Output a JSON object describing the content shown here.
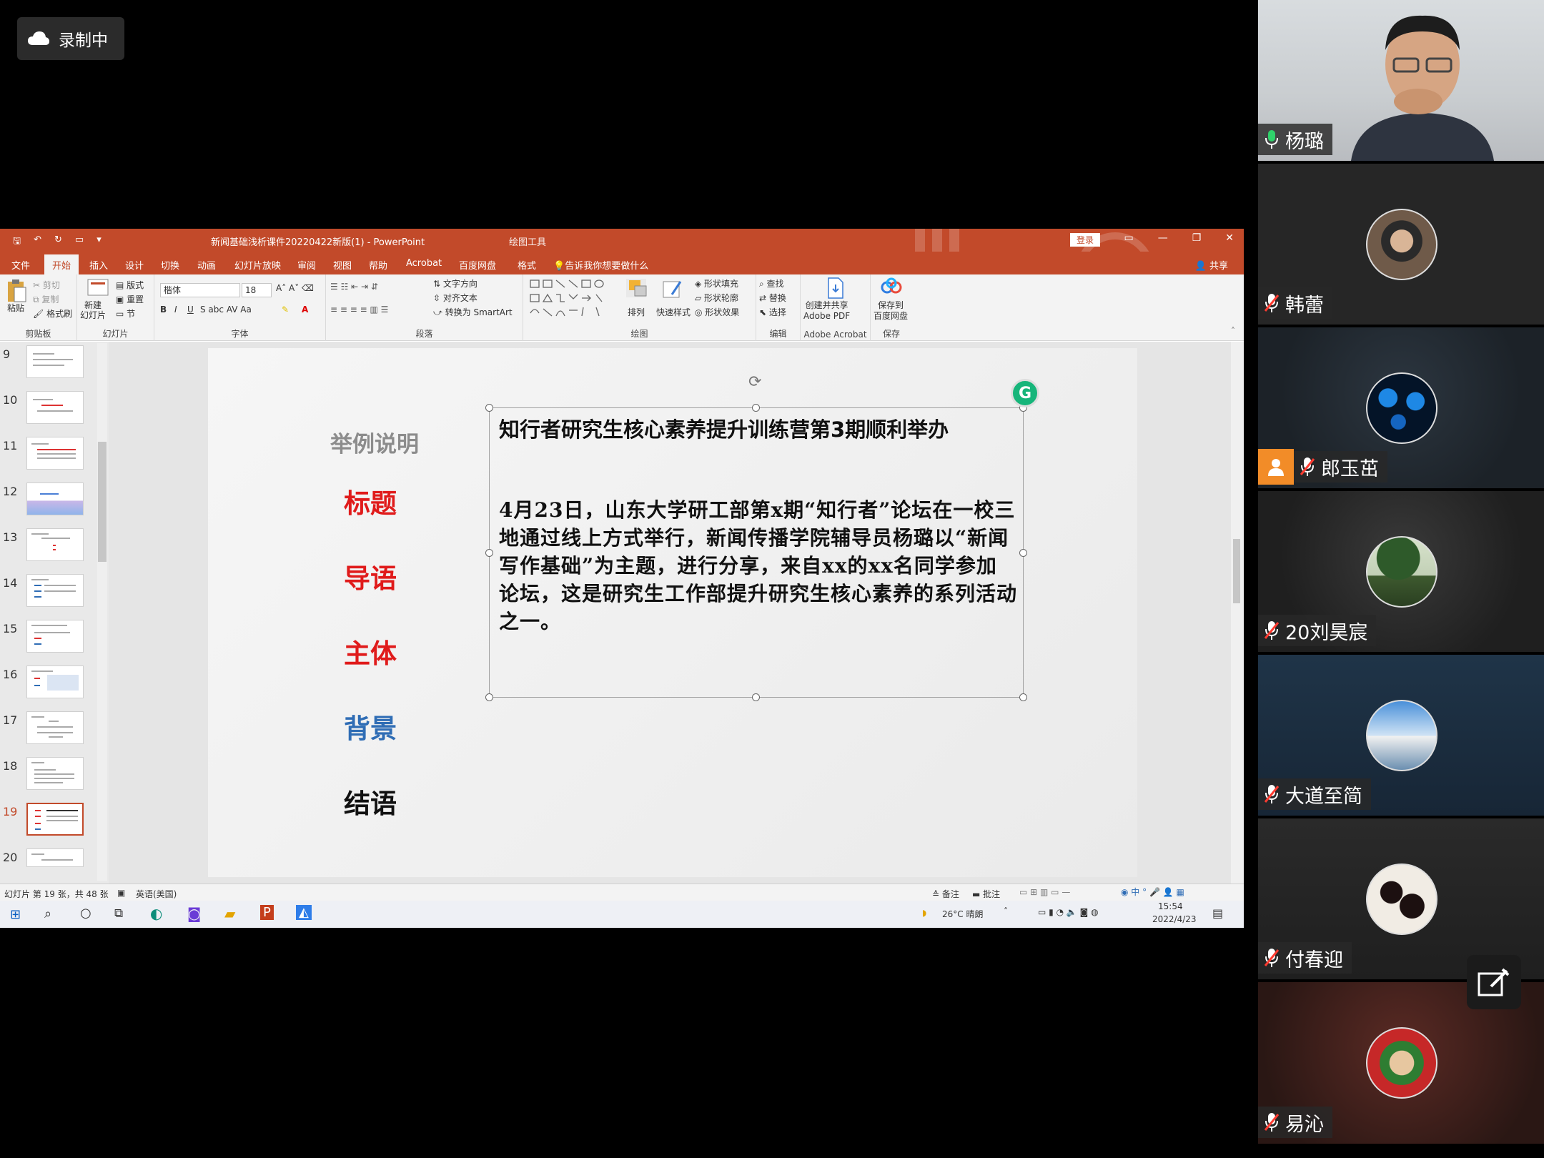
{
  "recording": {
    "label": "录制中"
  },
  "ppt": {
    "title": "新闻基础浅析课件20220422新版(1)  -  PowerPoint",
    "context_tab": "绘图工具",
    "login": "登录",
    "tabs": [
      "文件",
      "开始",
      "插入",
      "设计",
      "切换",
      "动画",
      "幻灯片放映",
      "审阅",
      "视图",
      "帮助",
      "Acrobat",
      "百度网盘",
      "格式"
    ],
    "tell_me": "告诉我你想要做什么",
    "share": "共享",
    "ribbon": {
      "clipboard": {
        "paste": "粘贴",
        "cut": "剪切",
        "copy": "复制",
        "format_painter": "格式刷",
        "label": "剪贴板"
      },
      "slides": {
        "new_slide": "新建\n幻灯片",
        "layout": "版式",
        "reset": "重置",
        "section": "节",
        "label": "幻灯片"
      },
      "font": {
        "name": "楷体",
        "size": "18",
        "label": "字体"
      },
      "paragraph": {
        "text_direction": "文字方向",
        "align_text": "对齐文本",
        "smartart": "转换为 SmartArt",
        "label": "段落"
      },
      "drawing": {
        "arrange": "排列",
        "quick_styles": "快速样式",
        "shape_fill": "形状填充",
        "shape_outline": "形状轮廓",
        "shape_effects": "形状效果",
        "label": "绘图"
      },
      "editing": {
        "find": "查找",
        "replace": "替换",
        "select": "选择",
        "label": "编辑"
      },
      "acrobat": {
        "create": "创建并共享\nAdobe PDF",
        "label": "Adobe Acrobat"
      },
      "save": {
        "button": "保存到\n百度网盘",
        "label": "保存"
      }
    },
    "thumbnails": [
      {
        "num": "9"
      },
      {
        "num": "10"
      },
      {
        "num": "11"
      },
      {
        "num": "12"
      },
      {
        "num": "13"
      },
      {
        "num": "14"
      },
      {
        "num": "15"
      },
      {
        "num": "16"
      },
      {
        "num": "17"
      },
      {
        "num": "18"
      },
      {
        "num": "19"
      },
      {
        "num": "20"
      }
    ],
    "slide": {
      "heading": "举例说明",
      "items": [
        "标题",
        "导语",
        "主体",
        "背景",
        "结语"
      ],
      "item_colors": [
        "#e01b1b",
        "#e01b1b",
        "#e01b1b",
        "#2f6db5",
        "#111111"
      ],
      "headline": "知行者研究生核心素养提升训练营第3期顺利举办",
      "body": "4月23日，山东大学研工部第x期“知行者”论坛在一校三地通过线上方式举行，新闻传播学院辅导员杨璐以“新闻写作基础”为主题，进行分享，来自xx的xx名同学参加论坛，这是研究生工作部提升研究生核心素养的系列活动之一。"
    },
    "status": {
      "slide_info": "幻灯片 第 19 张，共 48 张",
      "language": "英语(美国)",
      "notes": "备注",
      "comments": "批注"
    },
    "taskbar": {
      "weather": "26°C  晴朗",
      "ime": "中",
      "time": "15:54",
      "date": "2022/4/23"
    },
    "accent": "#c24a2a"
  },
  "participants": [
    {
      "name": "杨璐",
      "mic": "on"
    },
    {
      "name": "韩蕾",
      "mic": "muted"
    },
    {
      "name": "郎玉茁",
      "mic": "muted"
    },
    {
      "name": "20刘昊宸",
      "mic": "muted"
    },
    {
      "name": "大道至简",
      "mic": "muted"
    },
    {
      "name": "付春迎",
      "mic": "muted"
    },
    {
      "name": "易沁",
      "mic": "muted"
    }
  ]
}
